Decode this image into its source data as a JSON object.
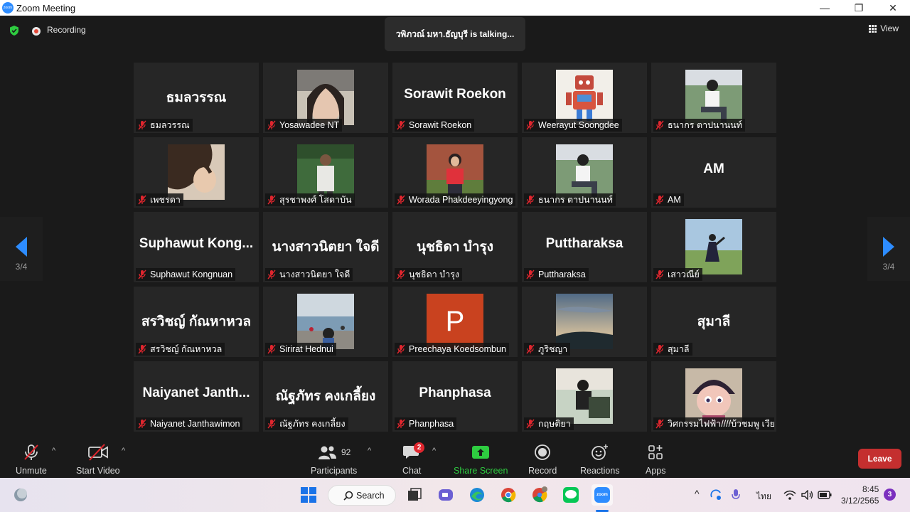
{
  "window": {
    "title": "Zoom Meeting",
    "logo_text": "zoom",
    "minimize": "—",
    "maximize": "❐",
    "close": "✕"
  },
  "top": {
    "recording_label": "Recording",
    "talking": "วพิภวณ์ มหา.ธัญบุรี is  talking...",
    "view_label": "View"
  },
  "nav": {
    "page_left": "3/4",
    "page_right": "3/4"
  },
  "tiles": [
    {
      "name": "ธมลวรรณ",
      "big": "ธมลวรรณ",
      "photo": null
    },
    {
      "name": "Yosawadee NT",
      "big": "",
      "photo": "girl-face"
    },
    {
      "name": "Sorawit Roekon",
      "big": "Sorawit Roekon",
      "photo": null
    },
    {
      "name": "Weerayut Soongdee",
      "big": "",
      "photo": "robot"
    },
    {
      "name": "ธนากร ตาปนานนท์",
      "big": "",
      "photo": "boy-sitting"
    },
    {
      "name": "เพชรดา",
      "big": "",
      "photo": "hair"
    },
    {
      "name": "สุรชาพงศ์ โสดาบัน",
      "big": "",
      "photo": "uniform"
    },
    {
      "name": "Worada Phakdeeyingyong",
      "big": "",
      "photo": "girl-red"
    },
    {
      "name": "ธนากร ตาปนานนท์",
      "big": "",
      "photo": "boy-sitting"
    },
    {
      "name": "AM",
      "big": "AM",
      "photo": null
    },
    {
      "name": "Suphawut Kongnuan",
      "big": "Suphawut  Kong...",
      "photo": null
    },
    {
      "name": "นางสาวนิตยา ใจดี",
      "big": "นางสาวนิตยา ใจดี",
      "photo": null
    },
    {
      "name": "นุชธิดา บำรุง",
      "big": "นุชธิดา บำรุง",
      "photo": null
    },
    {
      "name": "Puttharaksa",
      "big": "Puttharaksa",
      "photo": null
    },
    {
      "name": "เสาวณีย์",
      "big": "",
      "photo": "field"
    },
    {
      "name": "สรวิชญ์ กัณหาหวล",
      "big": "สรวิชญ์ กัณหาหวล",
      "photo": null
    },
    {
      "name": "Sirirat Hednui",
      "big": "",
      "photo": "pier"
    },
    {
      "name": "Preechaya Koedsombun",
      "big": "",
      "photo": "p-avatar",
      "avatar_letter": "P"
    },
    {
      "name": "ภูริชญา",
      "big": "",
      "photo": "sky"
    },
    {
      "name": "สุมาลี",
      "big": "สุมาลี",
      "photo": null
    },
    {
      "name": "Naiyanet Janthawimon",
      "big": "Naiyanet  Janth...",
      "photo": null
    },
    {
      "name": "ณัฐภัทร คงเกลี้ยง",
      "big": "ณัฐภัทร คงเกลี้ยง",
      "photo": null
    },
    {
      "name": "Phanphasa",
      "big": "Phanphasa",
      "photo": null
    },
    {
      "name": "กฤษติยา",
      "big": "",
      "photo": "girl-car"
    },
    {
      "name": "วิศกรรมไฟฟ้า////บ้วชมพู เวีย...",
      "big": "",
      "photo": "cartoon"
    }
  ],
  "toolbar": {
    "unmute": "Unmute",
    "start_video": "Start Video",
    "participants_count": "92",
    "participants": "Participants",
    "chat": "Chat",
    "chat_badge": "2",
    "share_screen": "Share Screen",
    "record": "Record",
    "reactions": "Reactions",
    "apps": "Apps",
    "leave": "Leave"
  },
  "taskbar": {
    "search": "Search",
    "lang": "ไทย",
    "time": "8:45",
    "date": "3/12/2565",
    "notif_count": "3",
    "zoom_icon_text": "zoom"
  },
  "colors": {
    "accent_green": "#2ecc40",
    "leave_red": "#c42f2f",
    "zoom_blue": "#2d8cff",
    "nav_arrow": "#2d8cff"
  }
}
